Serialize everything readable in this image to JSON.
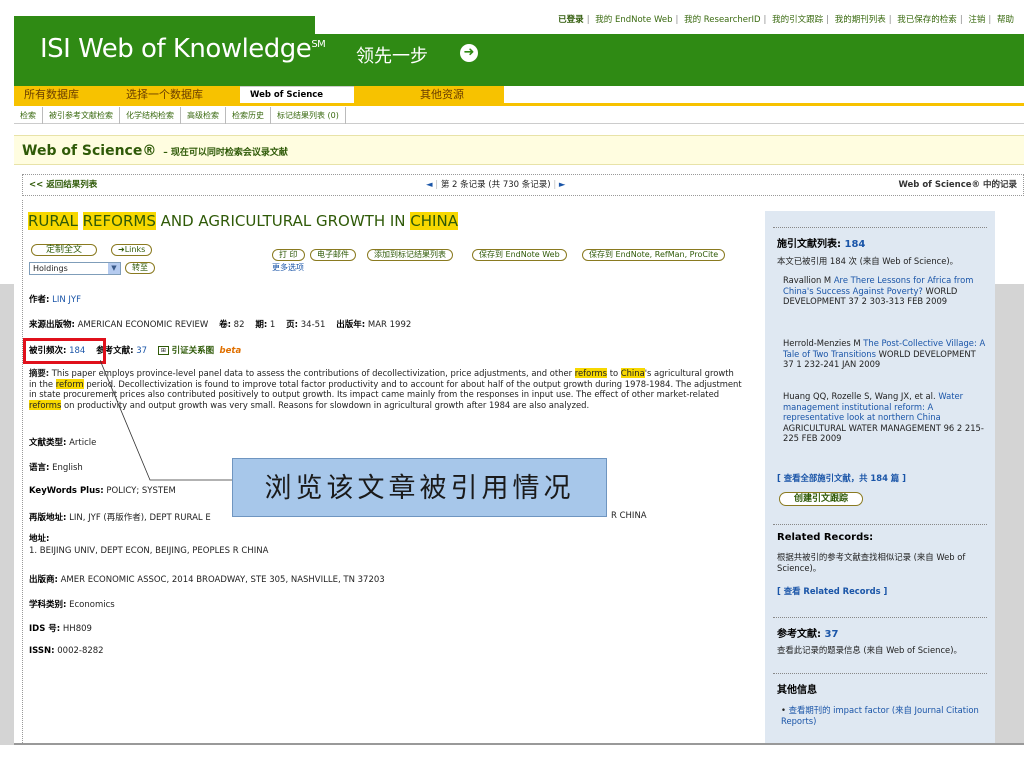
{
  "toplinks": {
    "items": [
      "已登录",
      "我的 EndNote Web",
      "我的 ResearcherID",
      "我的引文跟踪",
      "我的期刊列表",
      "我已保存的检索",
      "注销",
      "帮助"
    ]
  },
  "header": {
    "logo": "ISI Web of Knowledge",
    "logo_mark": "SM",
    "slogan": "领先一步"
  },
  "tabs": [
    "所有数据库",
    "选择一个数据库",
    "Web of Science",
    "其他资源"
  ],
  "subnav": [
    "检索",
    "被引参考文献检索",
    "化学结构检索",
    "高级检索",
    "检索历史",
    "标记结果列表 (0)"
  ],
  "wosbar": {
    "title": "Web of Science®",
    "subtitle": "– 现在可以同时检索会议录文献"
  },
  "recnav": {
    "back": "<< 返回结果列表",
    "mid": "第 2 条记录 (共 730 条记录)",
    "right": "Web of Science® 中的记录"
  },
  "record": {
    "title_parts": [
      "RURAL",
      " ",
      "REFORMS",
      " AND AGRICULTURAL GROWTH IN ",
      "CHINA"
    ],
    "fulltext": "定制全文",
    "links": "Links",
    "holdings": "Holdings",
    "goto": "转至",
    "actions": [
      "打 印",
      "电子邮件",
      "添加到标记结果列表",
      "保存到 EndNote Web",
      "保存到 EndNote, RefMan, ProCite"
    ],
    "more": "更多选项",
    "author_label": "作者:",
    "author": "LIN JYF",
    "source_label": "来源出版物:",
    "source": "AMERICAN ECONOMIC REVIEW",
    "vol_label": "卷:",
    "vol": "82",
    "issue_label": "期:",
    "issue": "1",
    "pages_label": "页:",
    "pages": "34-51",
    "year_label": "出版年:",
    "year": "MAR 1992",
    "cited_label": "被引频次:",
    "cited": "184",
    "refs_label": "参考文献:",
    "refs": "37",
    "citemap": "引证关系图",
    "beta": "beta",
    "abstract_label": "摘要:",
    "abstract_parts": [
      "This paper employs province-level panel data to assess the contributions of decollectivization, price adjustments, and other ",
      "reforms",
      " to ",
      "China",
      "'s agricultural growth in the ",
      "reform",
      " period. Decollectivization is found to improve total factor productivity and to account for about half of the output growth during 1978-1984. The adjustment in state procurement prices also contributed positively to output growth. Its impact came mainly from the responses in input use. The effect of other market-related ",
      "reforms",
      " on productivity and output growth was very small. Reasons for slowdown in agricultural growth after 1984 are also analyzed."
    ],
    "doctype_label": "文献类型:",
    "doctype": "Article",
    "lang_label": "语言:",
    "lang": "English",
    "kw_label": "KeyWords Plus:",
    "kw": "POLICY; SYSTEM",
    "reprint_label": "再版地址:",
    "reprint": "LIN, JYF (再版作者), DEPT RURAL E",
    "reprint_tail": "R CHINA",
    "addr_label": "地址:",
    "addr": "1. BEIJING UNIV, DEPT ECON, BEIJING, PEOPLES R CHINA",
    "pub_label": "出版商:",
    "pub": "AMER ECONOMIC ASSOC, 2014 BROADWAY, STE 305, NASHVILLE, TN 37203",
    "subj_label": "学科类别:",
    "subj": "Economics",
    "ids_label": "IDS 号:",
    "ids": "HH809",
    "issn_label": "ISSN:",
    "issn": "0002-8282"
  },
  "callout": "浏览该文章被引用情况",
  "sidebar": {
    "cited_title": "施引文献列表:",
    "cited_count": "184",
    "cited_desc": "本文已被引用 184 次 (来自 Web of Science)。",
    "citations": [
      {
        "authors": "Ravallion M",
        "title": "Are There Lessons for Africa from China's Success Against Poverty?",
        "source": "WORLD DEVELOPMENT 37 2 303-313 FEB 2009"
      },
      {
        "authors": "Herrold-Menzies M",
        "title": "The Post-Collective Village: A Tale of Two Transitions",
        "source": "WORLD DEVELOPMENT 37 1 232-241 JAN 2009"
      },
      {
        "authors": "Huang QQ, Rozelle S, Wang JX, et al.",
        "title": "Water management institutional reform: A representative look at northern China",
        "source": "AGRICULTURAL WATER MANAGEMENT 96 2 215-225 FEB 2009"
      }
    ],
    "view_all": "[ 查看全部施引文献，共 184 篇 ]",
    "create_alert": "创建引文跟踪",
    "related_title": "Related Records:",
    "related_desc": "根据共被引的参考文献查找相似记录 (来自 Web of Science)。",
    "related_link": "[ 查看 Related Records ]",
    "refs_title": "参考文献:",
    "refs_count": "37",
    "refs_desc": "查看此记录的题录信息 (来自 Web of Science)。",
    "other_title": "其他信息",
    "other_item": "查看期刊的 impact factor (来自 Journal Citation Reports)"
  }
}
